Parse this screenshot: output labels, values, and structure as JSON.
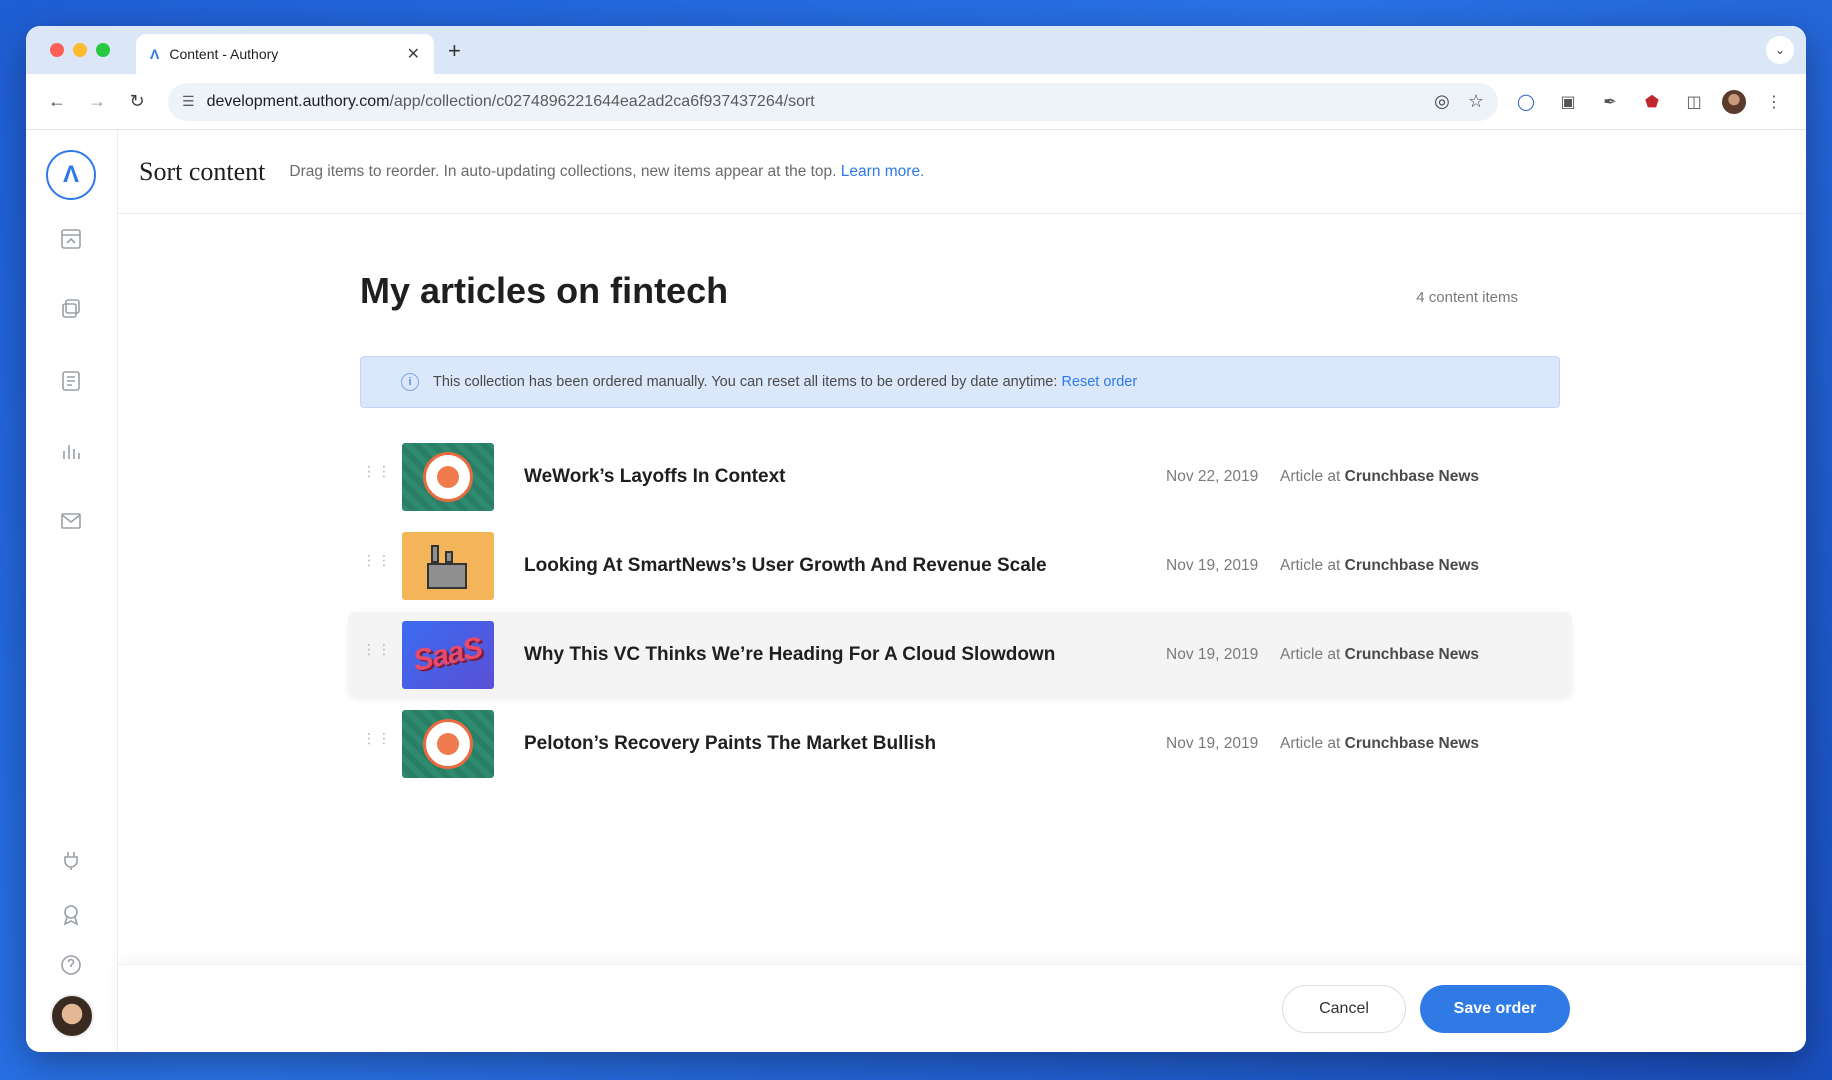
{
  "browser": {
    "tab_title": "Content - Authory",
    "url_host": "development.authory.com",
    "url_path": "/app/collection/c0274896221644ea2ad2ca6f937437264/sort",
    "traffic_colors": [
      "#ff5f57",
      "#febc2e",
      "#28c840"
    ]
  },
  "header": {
    "title": "Sort content",
    "description": "Drag items to reorder. In auto-updating collections, new items appear at the top.",
    "learn_more": "Learn more."
  },
  "collection": {
    "title": "My articles on fintech",
    "count": "4 content items"
  },
  "notice": {
    "text": "This collection has been ordered manually. You can reset all items to be ordered by date anytime:",
    "link": "Reset order"
  },
  "items": [
    {
      "title": "WeWork’s Layoffs In Context",
      "date": "Nov 22, 2019",
      "type": "Article at",
      "source": "Crunchbase News"
    },
    {
      "title": "Looking At SmartNews’s User Growth And Revenue Scale",
      "date": "Nov 19, 2019",
      "type": "Article at",
      "source": "Crunchbase News"
    },
    {
      "title": "Why This VC Thinks We’re Heading For A Cloud Slowdown",
      "date": "Nov 19, 2019",
      "type": "Article at",
      "source": "Crunchbase News"
    },
    {
      "title": "Peloton’s Recovery Paints The Market Bullish",
      "date": "Nov 19, 2019",
      "type": "Article at",
      "source": "Crunchbase News"
    }
  ],
  "footer": {
    "cancel": "Cancel",
    "save": "Save order"
  },
  "colors": {
    "accent": "#2f7ae5"
  }
}
